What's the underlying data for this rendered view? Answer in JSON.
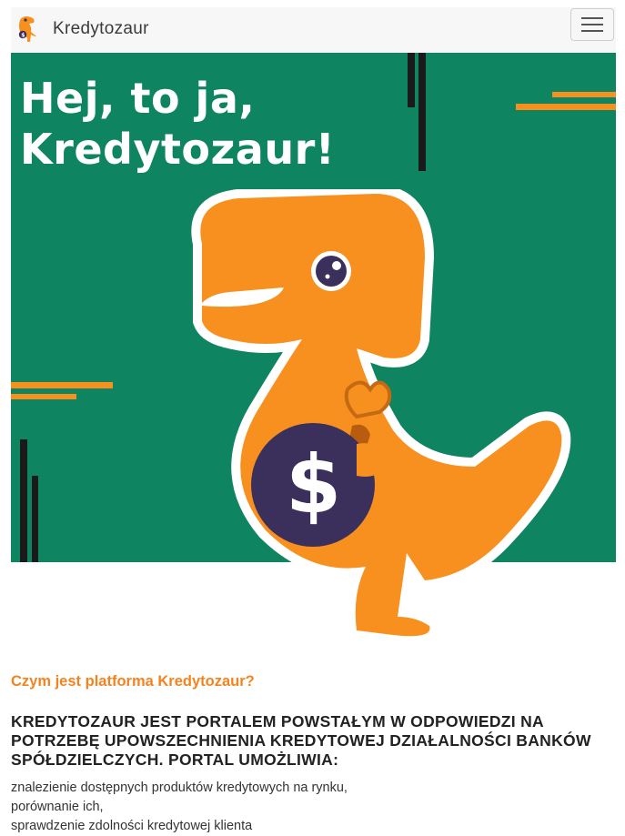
{
  "navbar": {
    "brand_name": "Kredytozaur",
    "logo_icon": "dinosaur-logo-icon",
    "menu_icon": "hamburger-menu-icon"
  },
  "hero": {
    "title_line1": "Hej, to ja,",
    "title_line2": "Kredytozaur!",
    "background_color": "#0f8460",
    "illustration": "orange-dinosaur-with-money-bag",
    "money_symbol": "$"
  },
  "about": {
    "kicker": "Czym jest platforma Kredytozaur?",
    "heading_line1": "KREDYTOZAUR JEST PORTALEM POWSTAŁYM W ODPOWIEDZI NA",
    "heading_line2": "POTRZEBĘ UPOWSZECHNIENIA KREDYTOWEJ DZIAŁALNOŚCI BANKÓW",
    "heading_line3": "SPÓŁDZIELCZYCH. PORTAL UMOŻLIWIA:",
    "items": [
      "znalezienie dostępnych produktów kredytowych na rynku,",
      "porównanie ich,",
      "sprawdzenie zdolności kredytowej klienta"
    ]
  },
  "colors": {
    "accent": "#f4831f",
    "hero_green": "#0f8460",
    "dino_orange": "#f7901e",
    "bag_navy": "#3b2f5c"
  }
}
